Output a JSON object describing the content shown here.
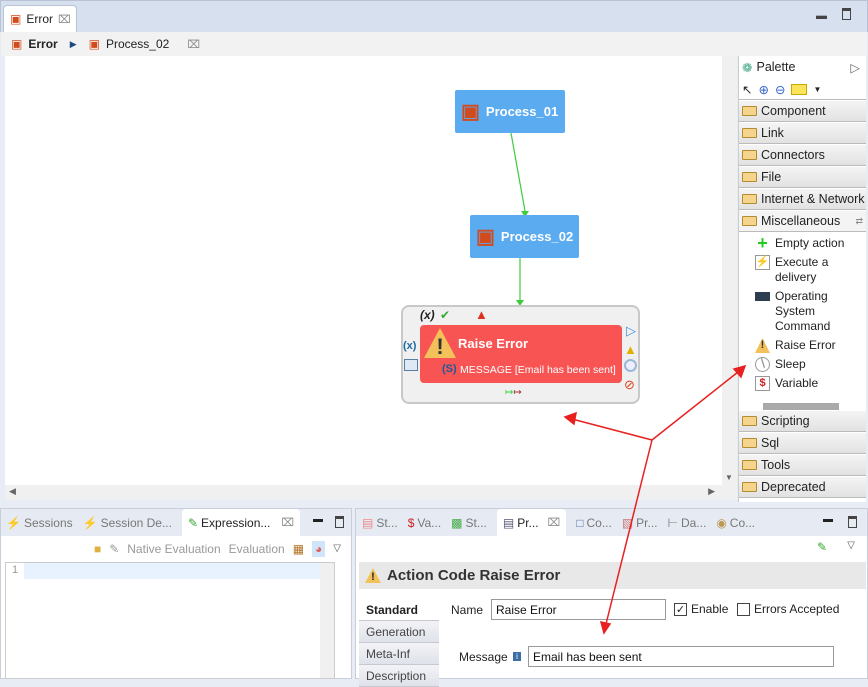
{
  "editor": {
    "tab_label": "Error",
    "breadcrumb": [
      "Error",
      "Process_02"
    ]
  },
  "diagram": {
    "nodes": [
      "Process_01",
      "Process_02"
    ],
    "action": {
      "title": "Raise Error",
      "parameter": "MESSAGE [Email has been sent]",
      "color": "#f85454"
    },
    "process_color": "#5aabf0"
  },
  "palette": {
    "title": "Palette",
    "folders_top": [
      "Component",
      "Link",
      "Connectors",
      "File",
      "Internet & Network"
    ],
    "open_folder": "Miscellaneous",
    "items": [
      "Empty action",
      "Execute a delivery",
      "Operating System Command",
      "Raise Error",
      "Sleep",
      "Variable"
    ],
    "folders_bottom": [
      "Scripting",
      "Sql",
      "Tools",
      "Deprecated"
    ]
  },
  "left_panel": {
    "tabs": [
      "Sessions",
      "Session De...",
      "Expression..."
    ],
    "toolbar": {
      "native_eval": "Native Evaluation",
      "eval": "Evaluation"
    },
    "line_number": "1"
  },
  "right_panel": {
    "tabs": [
      "St...",
      "Va...",
      "St...",
      "Pr...",
      "Co...",
      "Pr...",
      "Da...",
      "Co..."
    ],
    "header": "Action Code Raise Error",
    "side_tabs": [
      "Standard",
      "Generation",
      "Meta-Inf",
      "Description"
    ],
    "name_label": "Name",
    "name_value": "Raise Error",
    "enable_label": "Enable",
    "enable_checked": true,
    "errors_label": "Errors Accepted",
    "errors_checked": false,
    "message_label": "Message",
    "message_value": "Email has been sent"
  }
}
